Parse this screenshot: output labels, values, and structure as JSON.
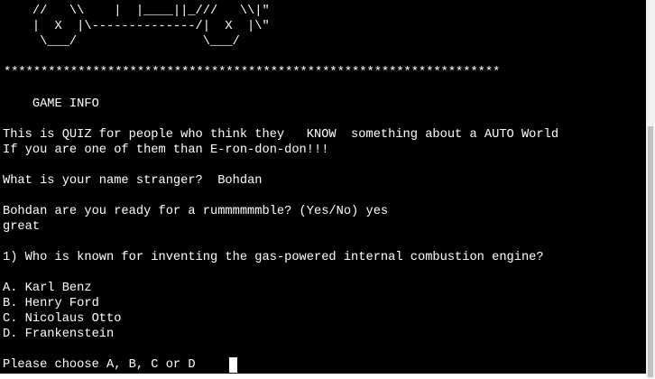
{
  "terminal": {
    "art": {
      "line1": "    //   \\\\    |  |____||_///   \\\\|\"",
      "line2": "    |  X  |\\--------------/|  X  |\\\"",
      "line3": "     \\___/                 \\___/"
    },
    "separator": "*******************************************************************",
    "game_info_title": "    GAME INFO",
    "intro": {
      "line1": "This is QUIZ for people who think they   KNOW  something about a AUTO World",
      "line2": "If you are one of them than E-ron-don-don!!!"
    },
    "name_prompt": {
      "question": "What is your name stranger?",
      "answer": "Bohdan"
    },
    "ready_prompt": {
      "question": "Bohdan are you ready for a rummmmmmble? (Yes/No)",
      "answer": "yes"
    },
    "ready_reply": "great",
    "quiz": {
      "question": "1) Who is known for inventing the gas-powered internal combustion engine?",
      "options": [
        "A. Karl Benz",
        "B. Henry Ford",
        "C. Nicolaus Otto",
        "D. Frankenstein"
      ]
    },
    "choice_prompt": "Please choose A, B, C or D"
  }
}
